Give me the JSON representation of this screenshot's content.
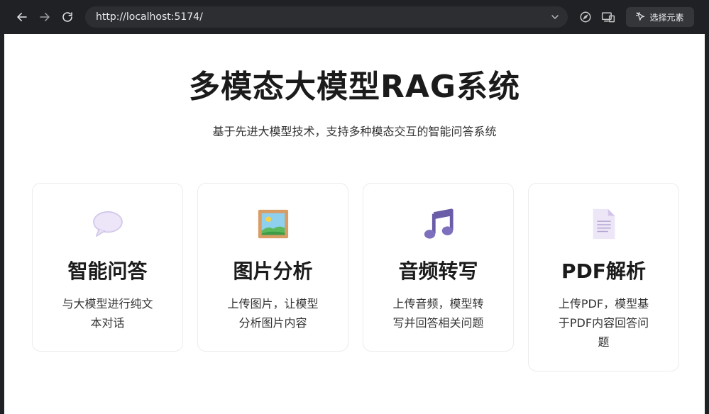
{
  "browser": {
    "url": "http://localhost:5174/",
    "select_element_label": "选择元素"
  },
  "page": {
    "title": "多模态大模型RAG系统",
    "subtitle": "基于先进大模型技术，支持多种模态交互的智能问答系统"
  },
  "cards": [
    {
      "icon": "speech-bubble-icon",
      "title": "智能问答",
      "description": "与大模型进行纯文本对话"
    },
    {
      "icon": "framed-picture-icon",
      "title": "图片分析",
      "description": "上传图片，让模型分析图片内容"
    },
    {
      "icon": "music-notes-icon",
      "title": "音频转写",
      "description": "上传音频，模型转写并回答相关问题"
    },
    {
      "icon": "document-icon",
      "title": "PDF解析",
      "description": "上传PDF，模型基于PDF内容回答问题"
    }
  ]
}
